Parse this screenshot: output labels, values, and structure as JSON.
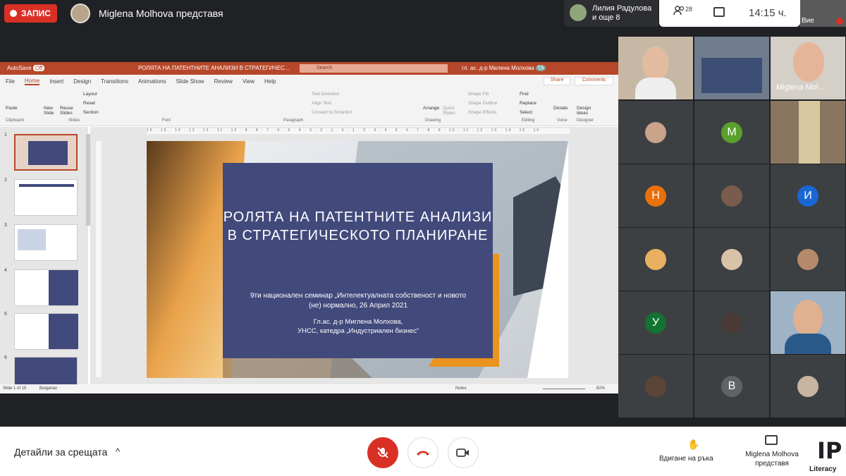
{
  "topbar": {
    "record_label": "ЗАПИС",
    "presenter_text": "Miglena Molhova представя",
    "people_line1": "Лилия Радулова",
    "people_line2": "и още 8",
    "participant_count": "28",
    "clock": "14:15 ч.",
    "self_label": "Вие"
  },
  "powerpoint": {
    "autosave": "AutoSave",
    "autosave_state": "Off",
    "doc_title": "РОЛЯТА НА ПАТЕНТНИТЕ АНАЛИЗИ В СТРАТЕГИЧЕС...",
    "search": "Search",
    "user": "гл. ас. д-р Милена Молхова",
    "user_initials": "ТА",
    "menu": [
      "File",
      "Home",
      "Insert",
      "Design",
      "Transitions",
      "Animations",
      "Slide Show",
      "Review",
      "View",
      "Help"
    ],
    "share": "Share",
    "comments": "Comments",
    "ribbon": {
      "paste": "Paste",
      "new_slide": "New Slide",
      "reuse_slides": "Reuse Slides",
      "layout": "Layout",
      "reset": "Reset",
      "section": "Section",
      "text_direction": "Text Direction",
      "align_text": "Align Text",
      "convert": "Convert to SmartArt",
      "arrange": "Arrange",
      "quick_styles": "Quick Styles",
      "shape_fill": "Shape Fill",
      "shape_outline": "Shape Outline",
      "shape_effects": "Shape Effects",
      "find": "Find",
      "replace": "Replace",
      "select": "Select",
      "dictate": "Dictate",
      "design_ideas": "Design Ideas",
      "groups": [
        "Clipboard",
        "Slides",
        "Font",
        "Paragraph",
        "Drawing",
        "Editing",
        "Voice",
        "Designer"
      ]
    },
    "slide": {
      "title": "РОЛЯТА НА ПАТЕНТНИТЕ АНАЛИЗИ В СТРАТЕГИЧЕСКОТО ПЛАНИРАНЕ",
      "subtitle": "9ти национален семинар „Интелектуалната собственост и новото (не) нормално, 26 Април 2021",
      "author_line1": "Гл.ас. д-р Миглена Молхова,",
      "author_line2": "УНСС, катедра „Индустриален бизнес“"
    },
    "thumb_numbers": [
      "1",
      "2",
      "3",
      "4",
      "5",
      "6"
    ],
    "status": {
      "slide_of": "Slide 1 of 15",
      "language": "Bulgarian",
      "notes": "Notes",
      "zoom": "82%"
    },
    "ruler": "16 · 15 · 14 · 13 · 12 · 11 · 10 · 9 · 8 · 7 · 6 · 5 · 4 · 3 · 2 · 1 · 0 · 1 · 2 · 3 · 4 · 5 · 6 · 7 · 8 · 9 · 10 · 11 · 12 · 13 · 14 · 15 · 16"
  },
  "participants": {
    "speaking_name": "Miglena Mol...",
    "tiles": [
      {
        "initial": "",
        "color": "#c9a38a"
      },
      {
        "initial": "M",
        "color": "#5aa02c"
      },
      {
        "initial": "H",
        "color": "#e8710a"
      },
      {
        "initial": "",
        "color": "#7a5c4d"
      },
      {
        "initial": "И",
        "color": "#1967d2"
      },
      {
        "initial": "",
        "color": "#e8b060"
      },
      {
        "initial": "",
        "color": "#d8c2a8"
      },
      {
        "initial": "",
        "color": "#b58a6a"
      },
      {
        "initial": "У",
        "color": "#137333"
      },
      {
        "initial": "",
        "color": "#4a3a35"
      },
      {
        "initial": "",
        "color": "#5a4538"
      },
      {
        "initial": "В",
        "color": "#5f6368"
      },
      {
        "initial": "",
        "color": "#c8b4a0"
      }
    ]
  },
  "bottombar": {
    "details": "Детайли за срещата",
    "raise_hand": "Вдигане на ръка",
    "presenting_line1": "Miglena Molhova",
    "presenting_line2": "представя",
    "logo_ip": "IP",
    "logo_text": "Literacy"
  }
}
